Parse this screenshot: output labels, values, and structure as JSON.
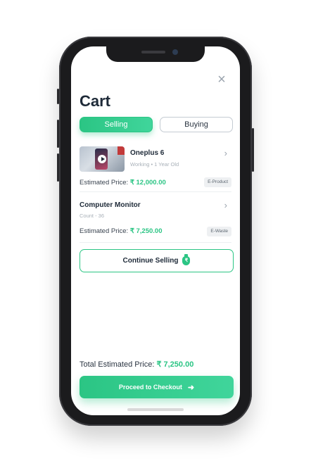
{
  "header": {
    "title": "Cart",
    "close_glyph": "×"
  },
  "tabs": [
    {
      "label": "Selling",
      "active": true
    },
    {
      "label": "Buying",
      "active": false
    }
  ],
  "items": [
    {
      "name": "Oneplus 6",
      "meta": "Working • 1 Year Old",
      "price_label": "Estimated Price: ",
      "price": "₹ 12,000.00",
      "badge": "E-Product",
      "has_thumbnail": true
    },
    {
      "name": "Computer Monitor",
      "meta": "Count - 36",
      "price_label": "Estimated Price: ",
      "price": "₹ 7,250.00",
      "badge": "E-Waste",
      "has_thumbnail": false
    }
  ],
  "continue_button": {
    "label": "Continue Selling"
  },
  "total": {
    "label": "Total Estimated Price: ",
    "value": "₹ 7,250.00"
  },
  "checkout_button": {
    "label": "Proceed to Checkout",
    "arrow": "➜"
  },
  "icons": {
    "close": "close-icon",
    "chevron": "chevron-right-icon",
    "play": "play-icon",
    "money": "money-bag-icon",
    "arrow": "arrow-right-icon"
  },
  "colors": {
    "accent": "#2bc584",
    "accent_light": "#40d59b",
    "text_dark": "#1e2a38",
    "text_muted": "#a8b0b8",
    "badge_bg": "#eef0f2"
  }
}
